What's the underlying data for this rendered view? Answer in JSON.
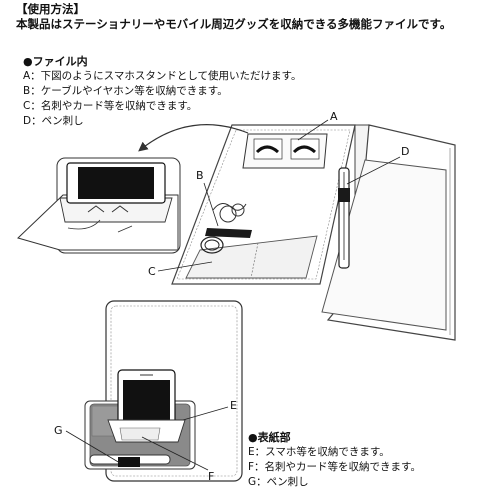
{
  "header": {
    "title": "【使用方法】",
    "intro": "本製品はステーショナリーやモバイル周辺グッズを収納できる多機能ファイルです。"
  },
  "inner_section": {
    "heading": "●ファイル内",
    "items": [
      "A：下図のようにスマホスタンドとして使用いただけます。",
      "B：ケーブルやイヤホン等を収納できます。",
      "C：名刺やカード等を収納できます。",
      "D：ペン刺し"
    ]
  },
  "cover_section": {
    "heading": "●表紙部",
    "items": [
      "E：スマホ等を収納できます。",
      "F：名刺やカード等を収納できます。",
      "G：ペン刺し"
    ]
  },
  "callouts": {
    "A": "A",
    "B": "B",
    "C": "C",
    "D": "D",
    "E": "E",
    "F": "F",
    "G": "G"
  }
}
